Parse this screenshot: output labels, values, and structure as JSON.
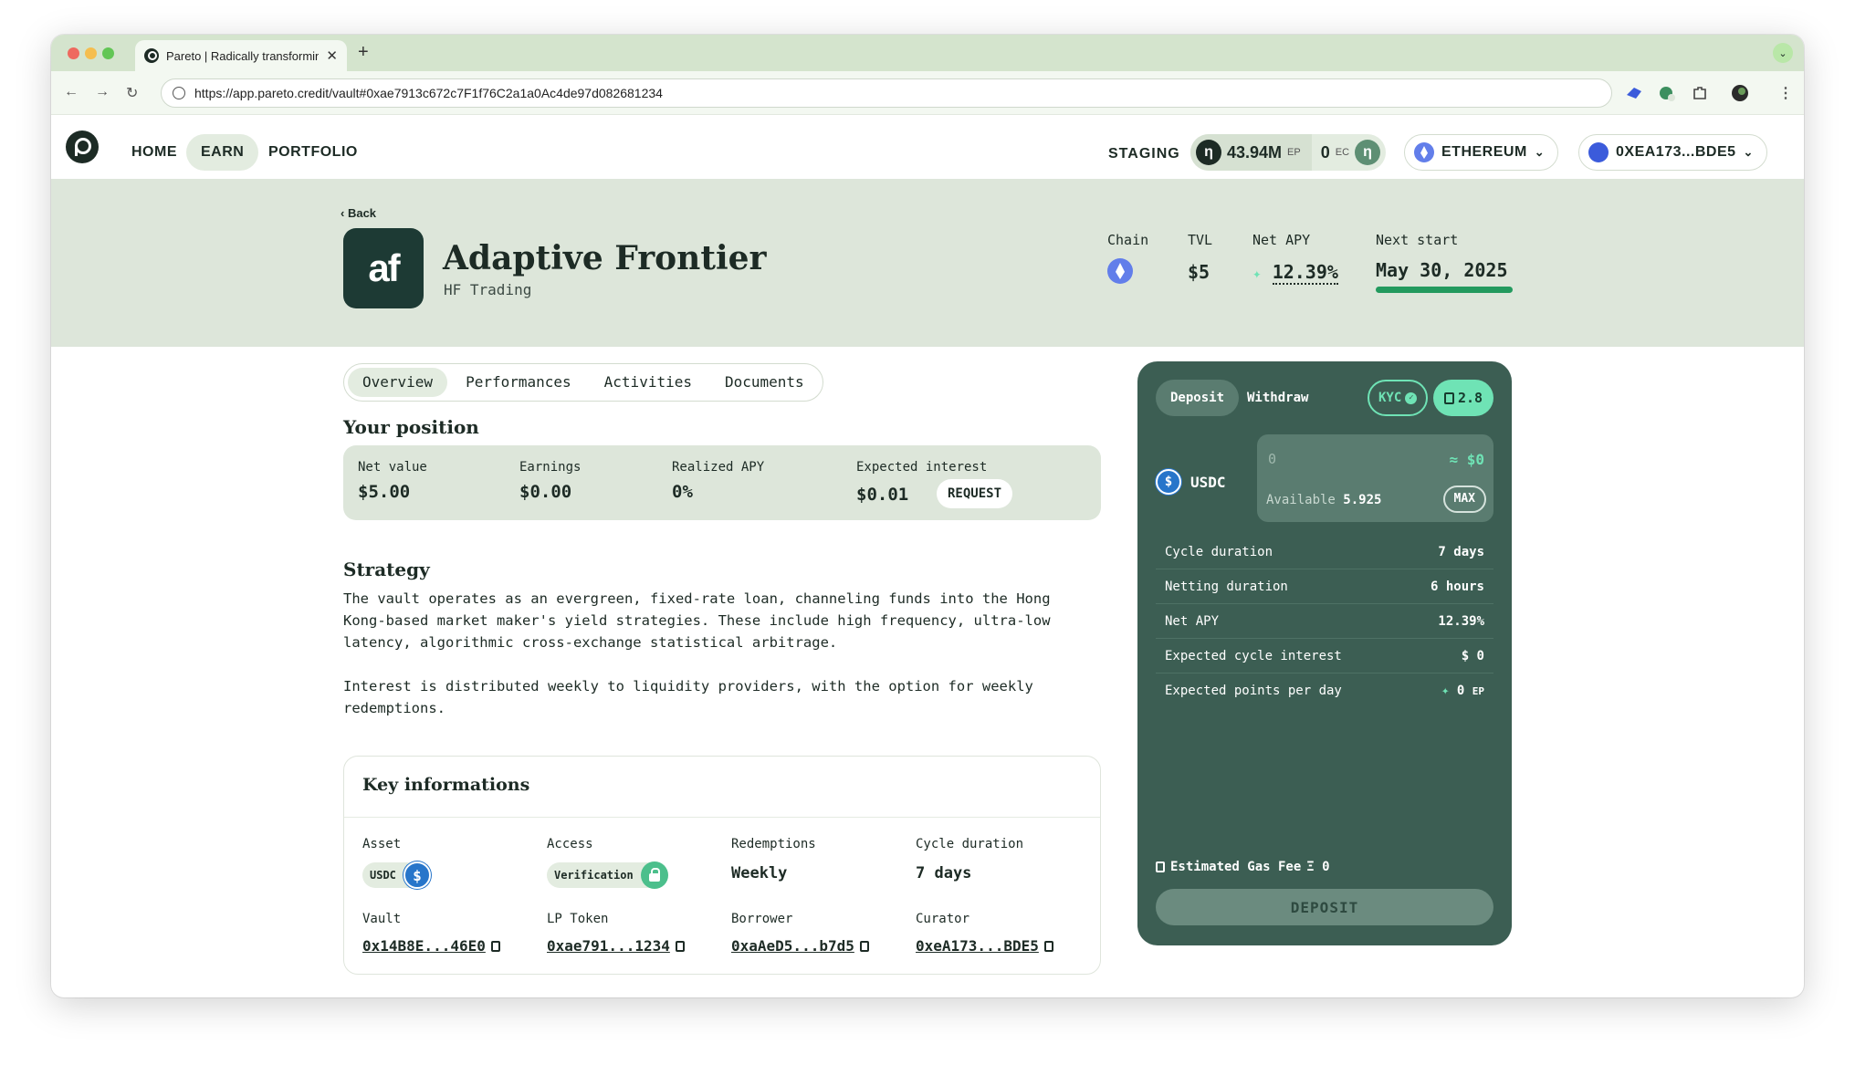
{
  "browser": {
    "tab_title": "Pareto | Radically transforming",
    "url": "https://app.pareto.credit/vault#0xae7913c672c7F1f76C2a1a0Ac4de97d082681234"
  },
  "nav": {
    "home": "HOME",
    "earn": "EARN",
    "portfolio": "PORTFOLIO",
    "staging": "STAGING",
    "points_value": "43.94M",
    "points_unit": "EP",
    "ec_value": "0",
    "ec_unit": "EC",
    "network": "ETHEREUM",
    "wallet": "0XEA173...BDE5",
    "badge_letter": "η"
  },
  "hero": {
    "back": "Back",
    "logo_text": "af",
    "title": "Adaptive Frontier",
    "subtitle": "HF Trading",
    "chain_label": "Chain",
    "tvl_label": "TVL",
    "tvl_value": "$5",
    "apy_label": "Net APY",
    "apy_value": "12.39%",
    "next_label": "Next start",
    "next_value": "May 30, 2025",
    "next_progress": 1.0
  },
  "tabs": [
    "Overview",
    "Performances",
    "Activities",
    "Documents"
  ],
  "position": {
    "heading": "Your position",
    "net_value_label": "Net value",
    "net_value": "$5.00",
    "earnings_label": "Earnings",
    "earnings": "$0.00",
    "realized_label": "Realized APY",
    "realized": "0%",
    "expected_label": "Expected interest",
    "expected": "$0.01",
    "request": "REQUEST"
  },
  "strategy": {
    "heading": "Strategy",
    "p1": "The vault operates as an evergreen, fixed-rate loan, channeling funds into the Hong Kong-based market maker's yield strategies. These include high frequency, ultra-low latency, algorithmic cross-exchange statistical arbitrage.",
    "p2": "Interest is distributed weekly to liquidity providers, with the option for weekly redemptions."
  },
  "key": {
    "heading": "Key informations",
    "asset_label": "Asset",
    "asset_chip": "USDC",
    "access_label": "Access",
    "access_chip": "Verification",
    "redemptions_label": "Redemptions",
    "redemptions": "Weekly",
    "cycle_label": "Cycle duration",
    "cycle": "7 days",
    "vault_label": "Vault",
    "vault": "0x14B8E...46E0",
    "lp_label": "LP Token",
    "lp": "0xae791...1234",
    "borrower_label": "Borrower",
    "borrower": "0xaAeD5...b7d5",
    "curator_label": "Curator",
    "curator": "0xeA173...BDE5"
  },
  "panel": {
    "deposit_tab": "Deposit",
    "withdraw_tab": "Withdraw",
    "kyc": "KYC",
    "gas_badge": "2.8",
    "token": "USDC",
    "amount_placeholder": "0",
    "amount_usd": "≈ $0",
    "available_label": "Available",
    "available": "5.925",
    "max": "MAX",
    "rows": [
      {
        "label": "Cycle duration",
        "value": "7 days"
      },
      {
        "label": "Netting duration",
        "value": "6 hours"
      },
      {
        "label": "Net APY",
        "value": "12.39%"
      },
      {
        "label": "Expected cycle interest",
        "value": "$ 0"
      },
      {
        "label": "Expected points per day",
        "value": "0",
        "unit": "EP"
      }
    ],
    "gas_label": "Estimated Gas Fee",
    "gas_value": "Ξ 0",
    "deposit_button": "DEPOSIT"
  },
  "colors": {
    "panel_bg": "#3c5e53",
    "accent": "#6fe3b5",
    "hero_bg": "#dde6da",
    "ink": "#1d2b25"
  }
}
